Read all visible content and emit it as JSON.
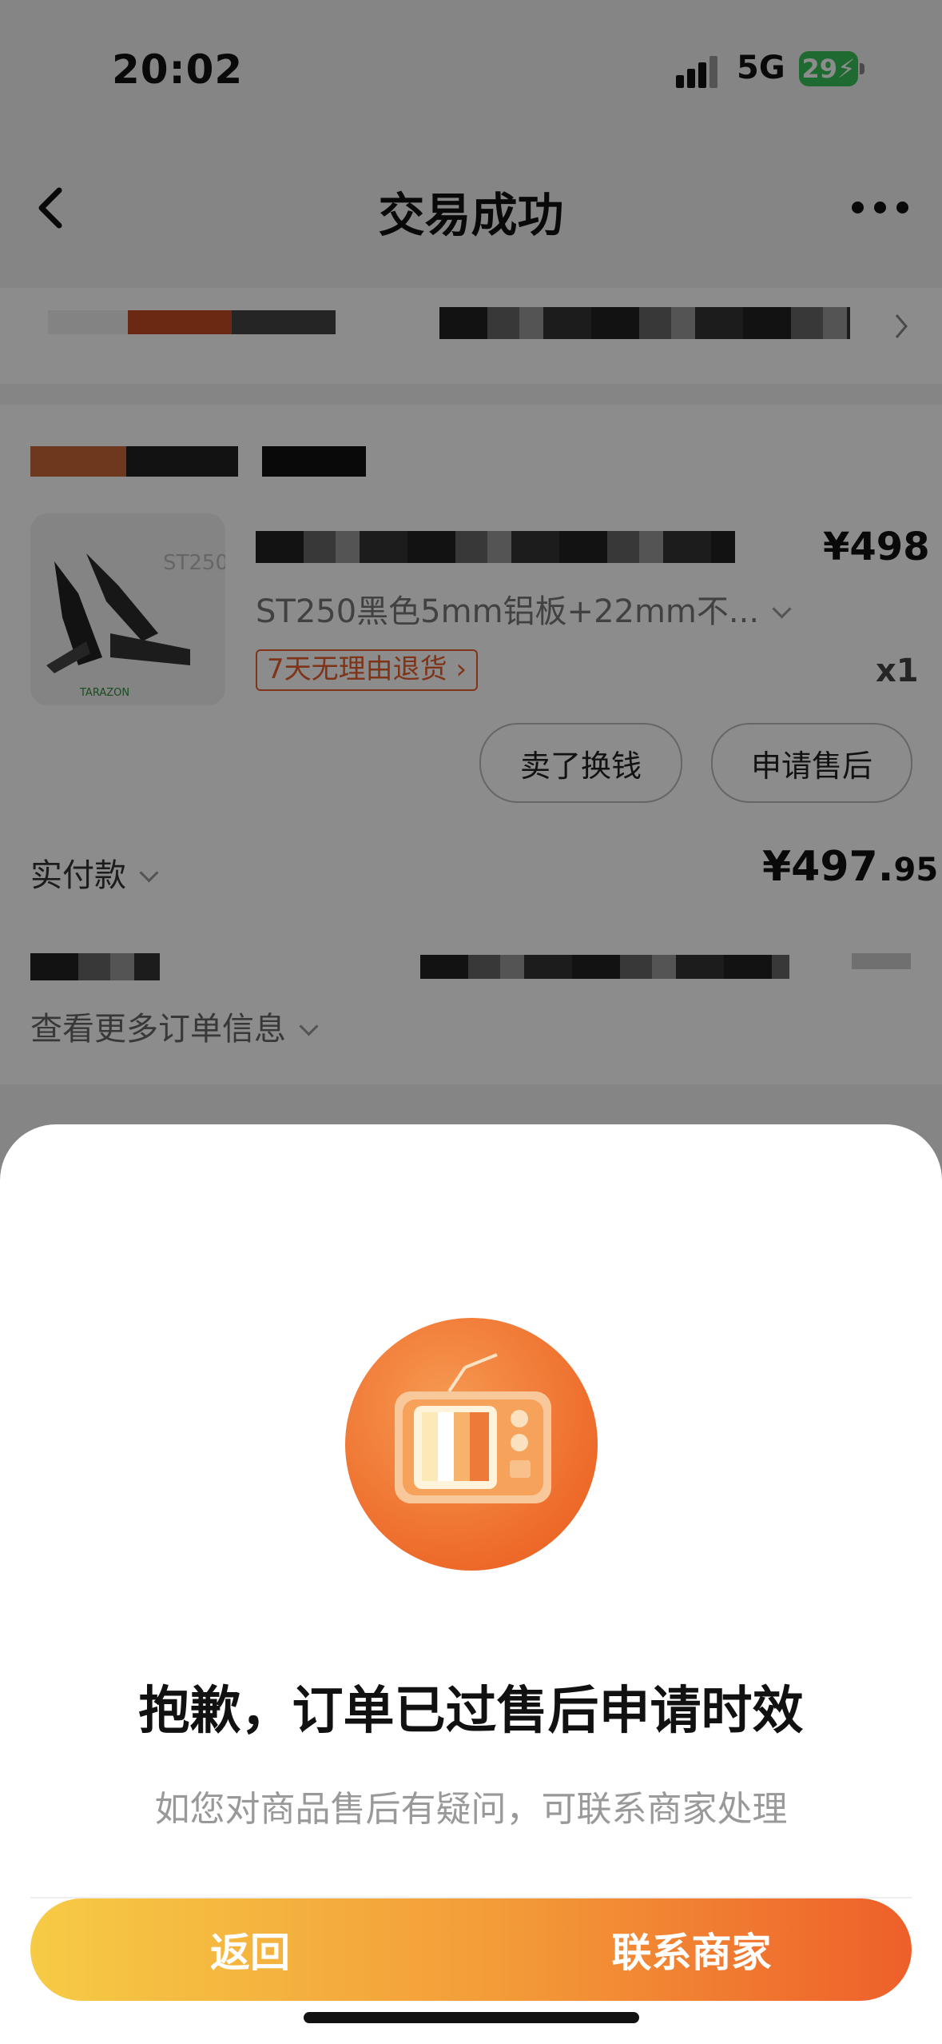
{
  "status_bar": {
    "time": "20:02",
    "network": "5G",
    "battery": "29"
  },
  "nav": {
    "title": "交易成功"
  },
  "order": {
    "product_price": "¥498",
    "spec": "ST250黑色5mm铝板+22mm不...",
    "return_tag": "7天无理由退货",
    "quantity": "x1",
    "btn_sell": "卖了换钱",
    "btn_after_sale": "申请售后",
    "paid_label": "实付款",
    "paid_amount_main": "¥497.",
    "paid_amount_cents": "95",
    "more_info": "查看更多订单信息"
  },
  "thumb": {
    "watermark": "ST250",
    "brand": "TARAZON"
  },
  "dialog": {
    "title": "抱歉，订单已过售后申请时效",
    "subtitle": "如您对商品售后有疑问，可联系商家处理",
    "btn_back": "返回",
    "btn_contact": "联系商家"
  },
  "colors": {
    "accent_start": "#f6cb45",
    "accent_end": "#ee5f2a",
    "tag": "#e8602c",
    "battery": "#39c25a"
  }
}
